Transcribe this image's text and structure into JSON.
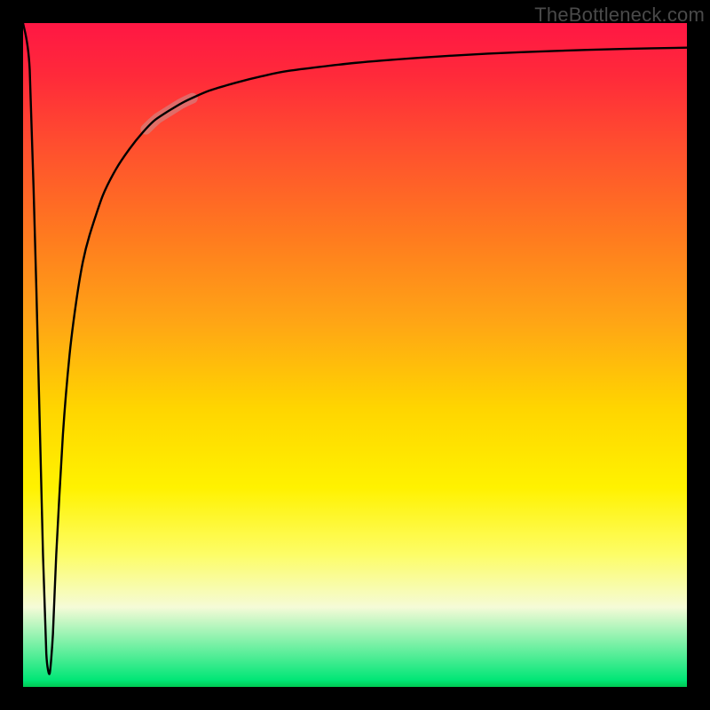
{
  "attribution": "TheBottleneck.com",
  "colors": {
    "gradient_top": "#ff1744",
    "gradient_mid": "#fff200",
    "gradient_bottom": "#00c853",
    "curve": "#000000",
    "marker": "#c79393",
    "frame": "#000000"
  },
  "chart_data": {
    "type": "line",
    "title": "",
    "xlabel": "",
    "ylabel": "",
    "xlim": [
      0,
      100
    ],
    "ylim": [
      0,
      100
    ],
    "series": [
      {
        "name": "bottleneck-curve",
        "x": [
          0.0,
          1.0,
          2.0,
          3.0,
          3.5,
          4.0,
          4.5,
          5.0,
          6.0,
          7.0,
          8.0,
          9.0,
          10.0,
          12.0,
          14.0,
          16.0,
          18.0,
          20.0,
          24.0,
          28.0,
          32.0,
          36.0,
          40.0,
          50.0,
          60.0,
          70.0,
          80.0,
          90.0,
          100.0
        ],
        "y": [
          100.0,
          93.0,
          60.0,
          20.0,
          5.0,
          2.0,
          8.0,
          20.0,
          38.0,
          50.0,
          58.0,
          64.0,
          68.0,
          74.0,
          78.0,
          81.0,
          83.5,
          85.5,
          88.0,
          89.8,
          91.0,
          92.0,
          92.8,
          94.0,
          94.8,
          95.4,
          95.8,
          96.1,
          96.3
        ]
      }
    ],
    "marker": {
      "name": "highlight-segment",
      "x_start": 18.5,
      "x_end": 25.5,
      "note": "short thick pale segment riding on the curve"
    }
  }
}
